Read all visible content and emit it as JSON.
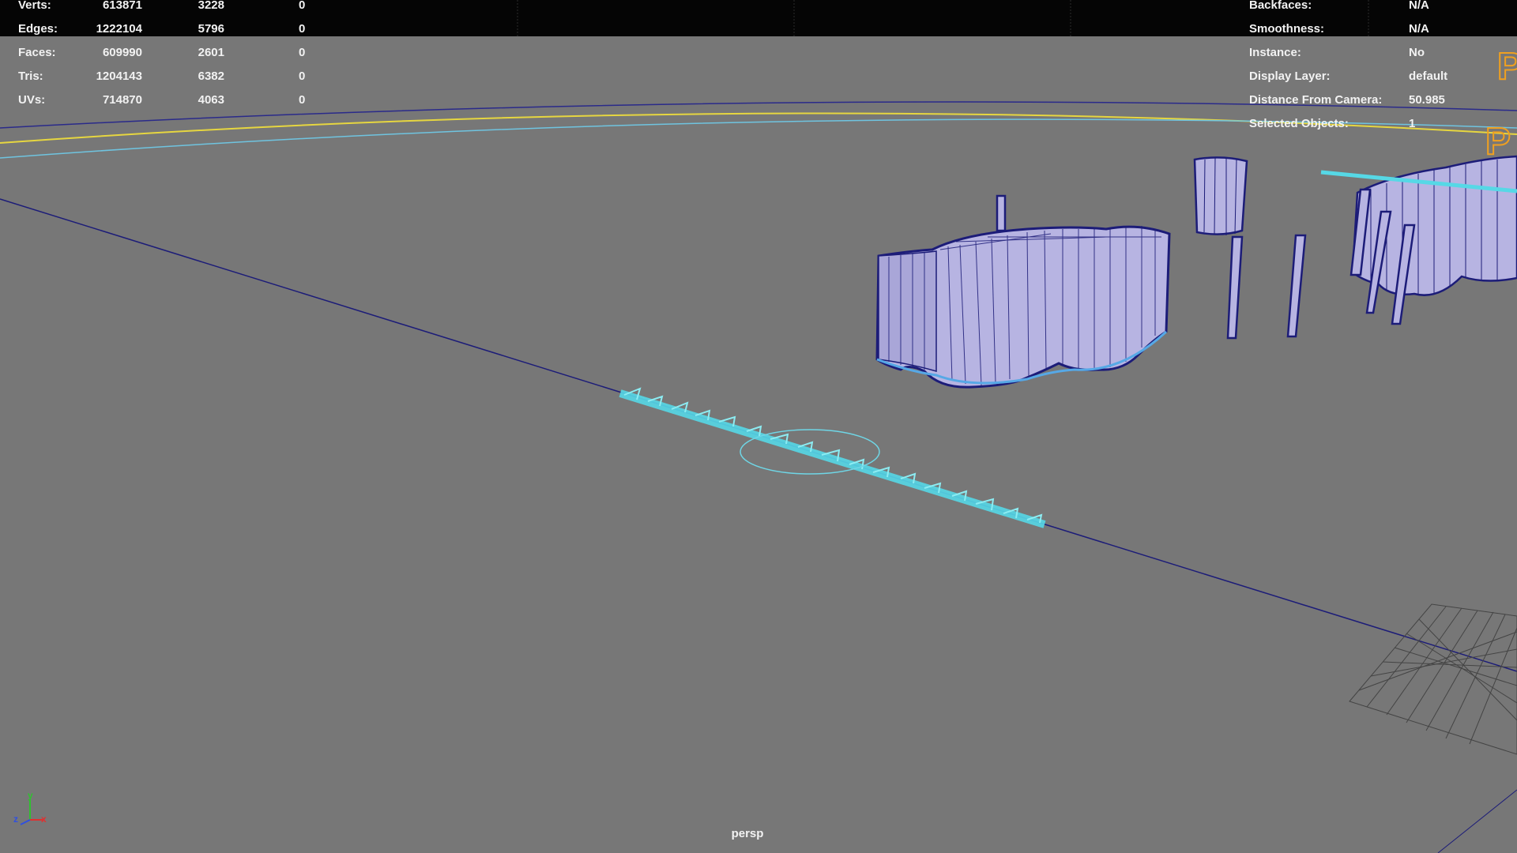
{
  "stats": [
    {
      "label": "Verts:",
      "a": "613871",
      "b": "3228",
      "c": "0"
    },
    {
      "label": "Edges:",
      "a": "1222104",
      "b": "5796",
      "c": "0"
    },
    {
      "label": "Faces:",
      "a": "609990",
      "b": "2601",
      "c": "0"
    },
    {
      "label": "Tris:",
      "a": "1204143",
      "b": "6382",
      "c": "0"
    },
    {
      "label": "UVs:",
      "a": "714870",
      "b": "4063",
      "c": "0"
    }
  ],
  "object_info": [
    {
      "label": "Backfaces:",
      "value": "N/A"
    },
    {
      "label": "Smoothness:",
      "value": "N/A"
    },
    {
      "label": "Instance:",
      "value": "No"
    },
    {
      "label": "Display Layer:",
      "value": "default"
    },
    {
      "label": "Distance From Camera:",
      "value": "50.985"
    },
    {
      "label": "Selected Objects:",
      "value": "1"
    }
  ],
  "camera_label": "persp",
  "axis": {
    "x": "x",
    "y": "y",
    "z": "z"
  },
  "colors": {
    "background": "#777777",
    "mesh_fill": "#b7b4e2",
    "mesh_wire": "#1c1c78",
    "selection": "#56d8e6",
    "horizon_yellow": "#e6d640",
    "orange_text": "#f0a020",
    "axis_x": "#e03030",
    "axis_y": "#30c030",
    "axis_z": "#3050e0"
  },
  "icons": [
    "axis-gizmo-icon"
  ]
}
